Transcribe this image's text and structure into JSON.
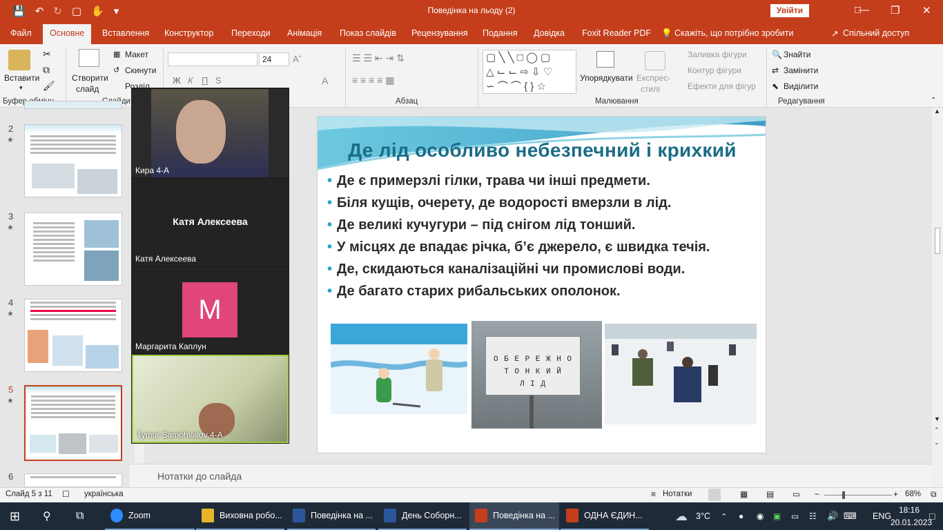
{
  "window": {
    "title": "Поведінка на льоду (2)",
    "signin": "Увійти"
  },
  "tabs": [
    "Файл",
    "Основне",
    "Вставлення",
    "Конструктор",
    "Переходи",
    "Анімація",
    "Показ слайдів",
    "Рецензування",
    "Подання",
    "Довідка",
    "Foxit Reader PDF"
  ],
  "tellme": "Скажіть, що потрібно зробити",
  "share": "Спільний доступ",
  "ribbon": {
    "paste": "Вставити",
    "clipboard": "Буфер обміну",
    "new_slide": "Створити",
    "new_slide2": "слайд",
    "layout": "Макет",
    "reset": "Скинути",
    "section": "Розділ",
    "slides": "Слайди",
    "font_size": "24",
    "bold": "Ж",
    "italic": "К",
    "underline": "П",
    "strike": "S",
    "paragraph": "Абзац",
    "arrange": "Упорядкувати",
    "quick_styles": "Експрес-",
    "quick_styles2": "стилі",
    "fill": "Заливка фігури",
    "outline": "Контур фігури",
    "effects": "Ефекти для фігур",
    "drawing": "Малювання",
    "find": "Знайти",
    "replace": "Замінити",
    "select": "Виділити",
    "editing": "Редагування"
  },
  "thumbnails": [
    {
      "num": "2"
    },
    {
      "num": "3"
    },
    {
      "num": "4"
    },
    {
      "num": "5"
    },
    {
      "num": "6"
    }
  ],
  "participants": [
    {
      "name": "Кира 4-А"
    },
    {
      "name": "Катя Алексеева",
      "display": "Катя Алексеева"
    },
    {
      "name": "Маргарита Каплун",
      "initial": "M"
    },
    {
      "name": "Tymur Samohvalov 4-A"
    }
  ],
  "slide": {
    "title": "Де лід особливо небезпечний і крихкий",
    "bullets": [
      "Де є примерзлі гілки, трава чи інші предмети.",
      "Біля кущів, очерету, де водорості вмерзли в лід.",
      "Де великі кучугури – під снігом лід тонший.",
      "У місцях де впадає річка, б’є джерело, є швидка течія.",
      "Де, скидаються каналізаційні чи промислові води.",
      "Де багато старих рибальських ополонок."
    ],
    "sign_text": [
      "О Б Е Р Е Ж Н О",
      "Т О Н К И Й",
      "Л І Д"
    ]
  },
  "notes": "Нотатки до слайда",
  "status": {
    "slide": "Слайд 5 з 11",
    "lang": "українська",
    "notes_btn": "Нотатки",
    "zoom": "68%"
  },
  "taskbar": {
    "apps": [
      {
        "label": "Zoom",
        "color": "#2d8cff"
      },
      {
        "label": "Виховна робо...",
        "color": "#e8b42c"
      },
      {
        "label": "Поведінка на ...",
        "color": "#2b579a"
      },
      {
        "label": "День Соборн...",
        "color": "#2b579a"
      },
      {
        "label": "Поведінка на ...",
        "color": "#c43e1c"
      },
      {
        "label": "ОДНА ЄДИН...",
        "color": "#c43e1c"
      }
    ],
    "temp": "3°C",
    "lang": "ENG",
    "time": "18:16",
    "date": "20.01.2023"
  }
}
